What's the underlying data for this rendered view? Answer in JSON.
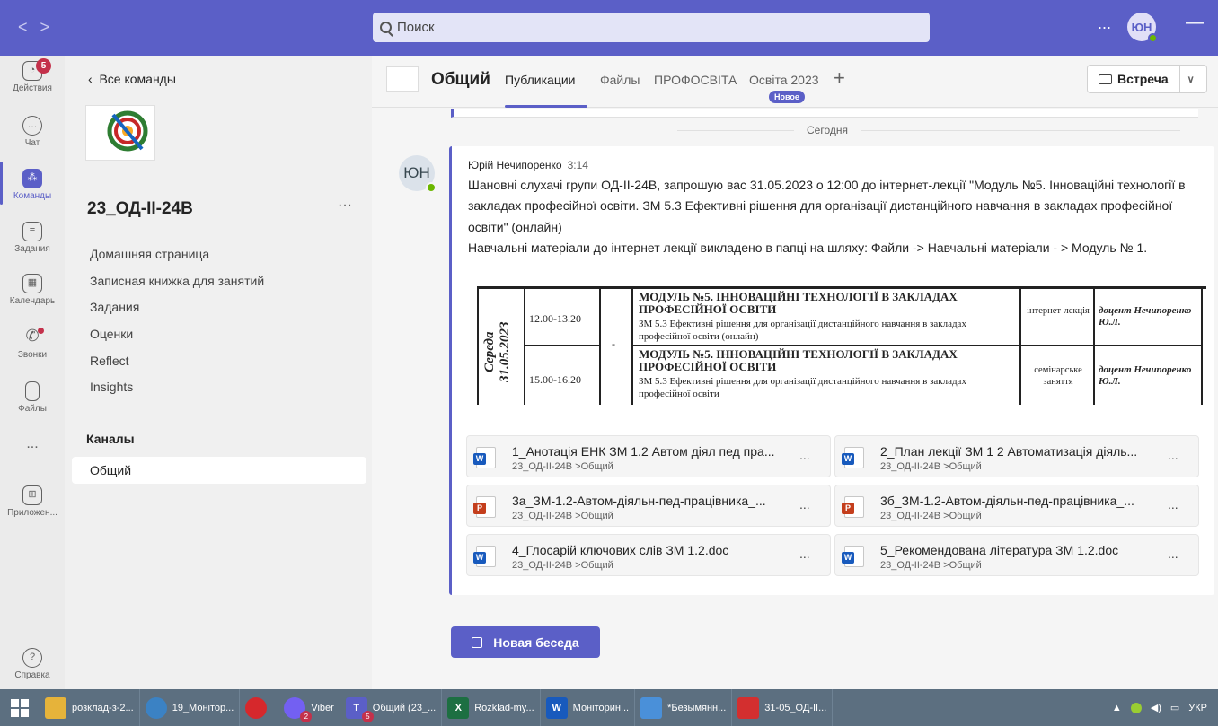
{
  "titlebar": {
    "back": "<",
    "forward": ">",
    "search_placeholder": "Поиск",
    "more": "...",
    "avatar_initials": "ЮН",
    "minimize": "—"
  },
  "rail": {
    "items": [
      {
        "label": "Действия",
        "icon": "bell-icon",
        "badge": "5"
      },
      {
        "label": "Чат",
        "icon": "chat-icon"
      },
      {
        "label": "Команды",
        "icon": "teams-icon"
      },
      {
        "label": "Задания",
        "icon": "assignments-icon"
      },
      {
        "label": "Календарь",
        "icon": "calendar-icon"
      },
      {
        "label": "Звонки",
        "icon": "phone-icon"
      },
      {
        "label": "Файлы",
        "icon": "file-icon"
      },
      {
        "label": "...",
        "icon": "more-icon"
      },
      {
        "label": "Приложен...",
        "icon": "apps-icon"
      },
      {
        "label": "Справка",
        "icon": "help-icon"
      }
    ]
  },
  "team_panel": {
    "back_label": "Все команды",
    "logo_text": "2023 КПК ПРОФЕСІЙНА (ПРОФЕСІЙНО ТЕХНІЧНА) ОСВІТА",
    "team_name": "23_ОД-ІІ-24В",
    "more": "···",
    "links": [
      "Домашняя страница",
      "Записная книжка для занятий",
      "Задания",
      "Оценки",
      "Reflect",
      "Insights"
    ],
    "channels_heading": "Каналы",
    "channel": "Общий"
  },
  "header": {
    "channel_title": "Общий",
    "tabs": [
      "Публикации",
      "Файлы",
      "ПРОФОСВІТА",
      "Освіта 2023"
    ],
    "new_badge": "Новое",
    "add": "+",
    "meet_label": "Встреча",
    "meet_chevron": "∨"
  },
  "feed": {
    "day_divider": "Сегодня",
    "author": "Юрій Нечипоренко",
    "time": "3:14",
    "avatar_initials": "ЮН",
    "text_1": "Шановні слухачі групи ОД-ІІ-24В, запрошую вас 31.05.2023 о 12:00 до інтернет-лекції \"Модуль №5. Інноваційні технології в закладах професійної освіти. ЗМ 5.3 Ефективні рішення для організації дистанційного навчання в закладах професійної освіти\" (онлайн)",
    "text_2": "Навчальні матеріали до інтернет лекції викладено в папці на шляху: Файли -> Навчальні матеріали - > Модуль № 1.",
    "schedule": {
      "day": "Середа 31.05.2023",
      "rows": [
        {
          "time": "12.00-13.20",
          "title": "МОДУЛЬ №5. ІННОВАЦІЙНІ ТЕХНОЛОГІЇ В ЗАКЛАДАХ ПРОФЕСІЙНОЇ ОСВІТИ",
          "sub": "ЗМ 5.3 Ефективні рішення для організації дистанційного навчання в закладах професійної освіти (онлайн)",
          "kind": "інтернет-лекція",
          "teacher": "доцент Нечипоренко Ю.Л."
        },
        {
          "time": "15.00-16.20",
          "title": "МОДУЛЬ №5. ІННОВАЦІЙНІ ТЕХНОЛОГІЇ В ЗАКЛАДАХ ПРОФЕСІЙНОЇ ОСВІТИ",
          "sub": "ЗМ 5.3 Ефективні рішення для організації дистанційного навчання в закладах професійної освіти",
          "kind": "семінарське заняття",
          "teacher": "доцент Нечипоренко Ю.Л."
        }
      ],
      "mid_mark": "-"
    },
    "attachments": [
      {
        "name": "1_Анотація ЕНК ЗМ 1.2 Автом діял пед пра...",
        "path": "23_ОД-ІІ-24В >Общий",
        "type": "word"
      },
      {
        "name": "2_План лекції ЗМ 1 2 Автоматизація діяль...",
        "path": "23_ОД-ІІ-24В >Общий",
        "type": "word"
      },
      {
        "name": "3а_ЗМ-1.2-Автом-діяльн-пед-працівника_...",
        "path": "23_ОД-ІІ-24В >Общий",
        "type": "ppt"
      },
      {
        "name": "3б_ЗМ-1.2-Автом-діяльн-пед-працівника_...",
        "path": "23_ОД-ІІ-24В >Общий",
        "type": "ppt"
      },
      {
        "name": "4_Глосарій ключових слів ЗМ 1.2.doc",
        "path": "23_ОД-ІІ-24В >Общий",
        "type": "word"
      },
      {
        "name": "5_Рекомендована література ЗМ 1.2.doc",
        "path": "23_ОД-ІІ-24В >Общий",
        "type": "word"
      }
    ],
    "attachment_more": "...",
    "new_conversation": "Новая беседа"
  },
  "taskbar": {
    "items": [
      {
        "label": "розклад-з-2...",
        "icon": "folder-icon",
        "color": "#e6b33a"
      },
      {
        "label": "19_Монітор...",
        "icon": "chrome-icon",
        "color": "#3b82c4"
      },
      {
        "label": "",
        "icon": "opera-icon",
        "color": "#d6282c"
      },
      {
        "label": "Viber",
        "icon": "viber-icon",
        "color": "#7360f2",
        "badge": "2"
      },
      {
        "label": "Общий (23_...",
        "icon": "teams-icon",
        "color": "#5b5fc7",
        "badge": "5"
      },
      {
        "label": "Rozklad-my...",
        "icon": "excel-icon",
        "color": "#1d6f42"
      },
      {
        "label": "Моніторин...",
        "icon": "word-icon",
        "color": "#185abd"
      },
      {
        "label": "*Безымянн...",
        "icon": "paint-icon",
        "color": "#4a90d9"
      },
      {
        "label": "31-05_ОД-ІІ...",
        "icon": "pdf-icon",
        "color": "#d32f2f"
      }
    ],
    "tray_lang": "УКР"
  }
}
